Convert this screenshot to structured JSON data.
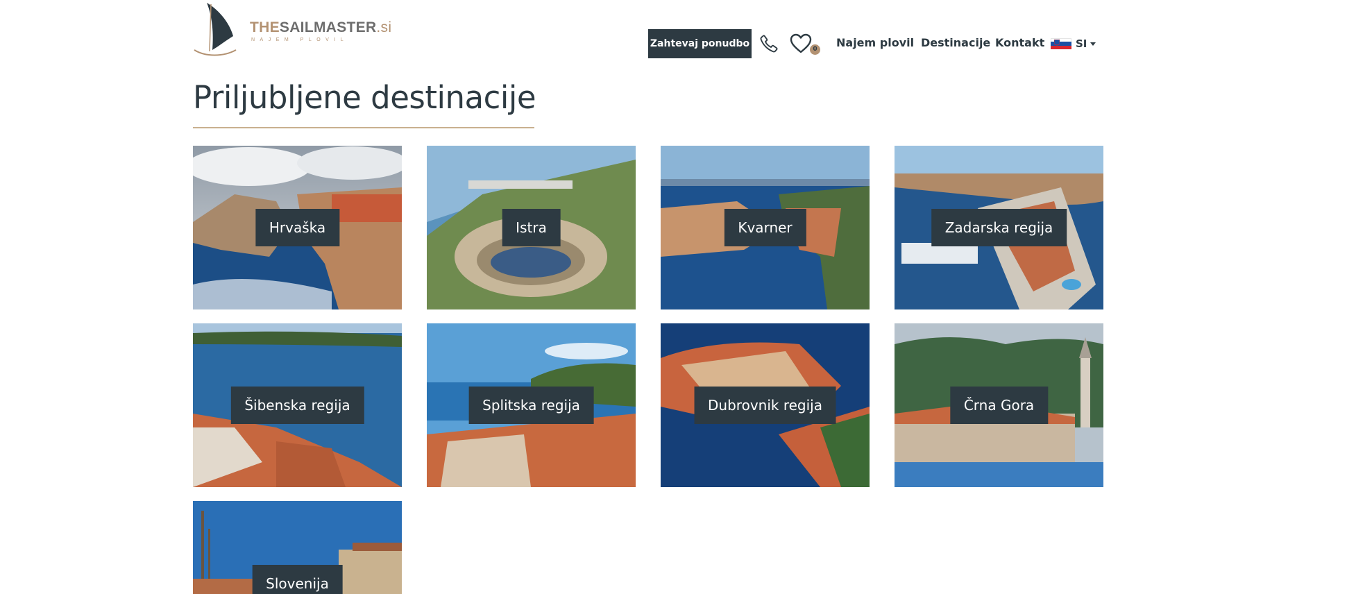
{
  "header": {
    "logo": {
      "the": "THE",
      "main": "SAILMASTER",
      "tld": ".si",
      "sub": "NAJEM PLOVIL"
    },
    "offer_button": "Zahtevaj ponudbo",
    "favorites_count": "0",
    "nav": [
      {
        "label": "Najem plovil"
      },
      {
        "label": "Destinacije"
      },
      {
        "label": "Kontakt"
      }
    ],
    "language": {
      "code": "SI"
    },
    "icons": [
      "sailboat-logo-icon",
      "phone-icon",
      "heart-icon",
      "slovenia-flag-icon",
      "chevron-down-icon"
    ]
  },
  "page": {
    "title": "Priljubljene destinacije"
  },
  "destinations": [
    {
      "name": "Hrvaška"
    },
    {
      "name": "Istra"
    },
    {
      "name": "Kvarner"
    },
    {
      "name": "Zadarska regija"
    },
    {
      "name": "Šibenska regija"
    },
    {
      "name": "Splitska regija"
    },
    {
      "name": "Dubrovnik regija"
    },
    {
      "name": "Črna Gora"
    },
    {
      "name": "Slovenija"
    }
  ],
  "colors": {
    "primary_dark": "#2d3a42",
    "accent_gold": "#b39272",
    "underline": "#c9b08f",
    "sea": "#1f4f86",
    "roof": "#c85a3a"
  }
}
